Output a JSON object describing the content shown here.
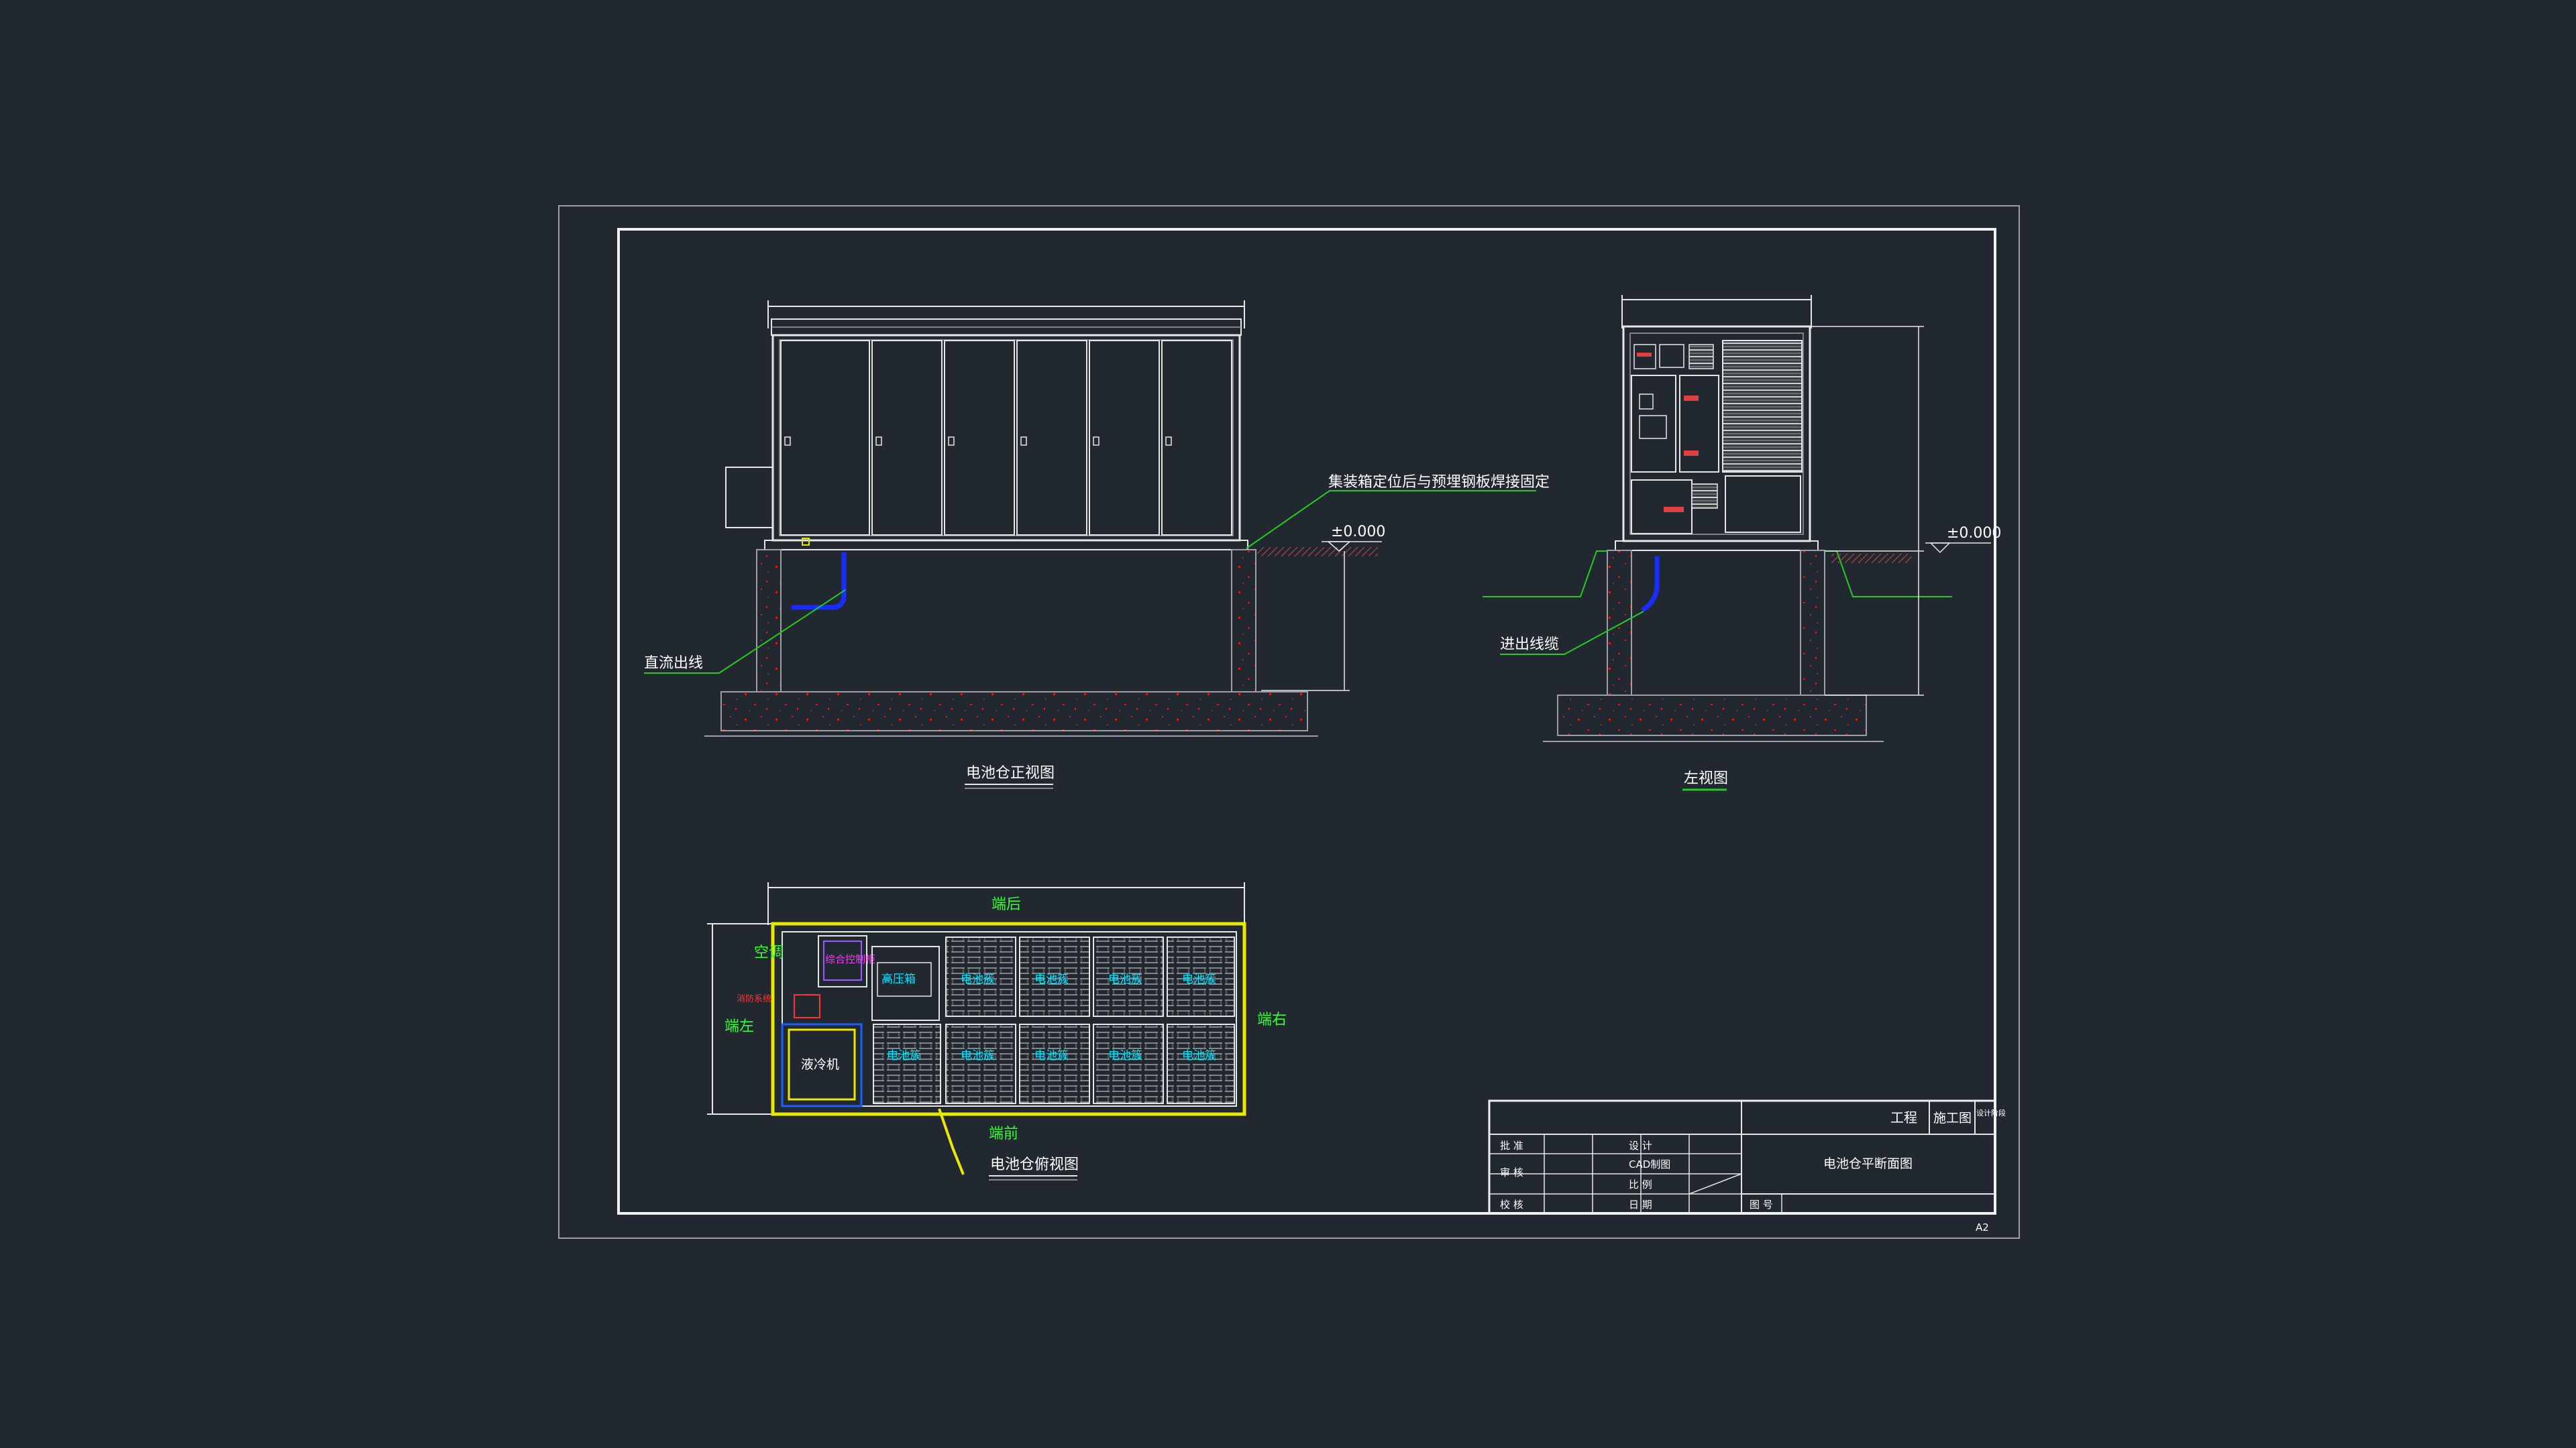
{
  "colors": {
    "background": "#212830",
    "line_white": "#e6e6e6",
    "line_gray": "#9aa0a6",
    "leader_green": "#22cc22",
    "cable_blue": "#1a2dff",
    "outline_yellow": "#e8e800",
    "text_cyan": "#00e5ff",
    "text_magenta": "#ff33ff",
    "text_red": "#ff3333",
    "concrete_red": "#d02020"
  },
  "front_view": {
    "title": "电池仓正视图",
    "annotation_weld": "集装箱定位后与预埋钢板焊接固定",
    "annotation_dc": "直流出线",
    "level_mark": "±0.000"
  },
  "side_view": {
    "title": "左视图",
    "annotation_cable": "进出线缆",
    "level_mark": "±0.000"
  },
  "plan_view": {
    "title": "电池仓俯视图",
    "label_rear": "端后",
    "label_front": "端前",
    "label_left": "端左",
    "label_right": "端右",
    "label_ac": "空调",
    "label_chiller": "液冷机",
    "label_hv_box": "高压箱",
    "label_control_cabinet": "综合控制柜",
    "label_fire": "消防系统",
    "label_battery": "电池簇"
  },
  "title_block": {
    "project": "工程",
    "stage_value": "施工图",
    "stage_label": "设计阶段",
    "drawing_name": "电池仓平断面图",
    "approve": "批 准",
    "review": "审 核",
    "check": "校 核",
    "design": "设 计",
    "cad": "CAD制图",
    "scale": "比 例",
    "date": "日 期",
    "drawing_no": "图 号"
  },
  "sheet_size": "A2"
}
